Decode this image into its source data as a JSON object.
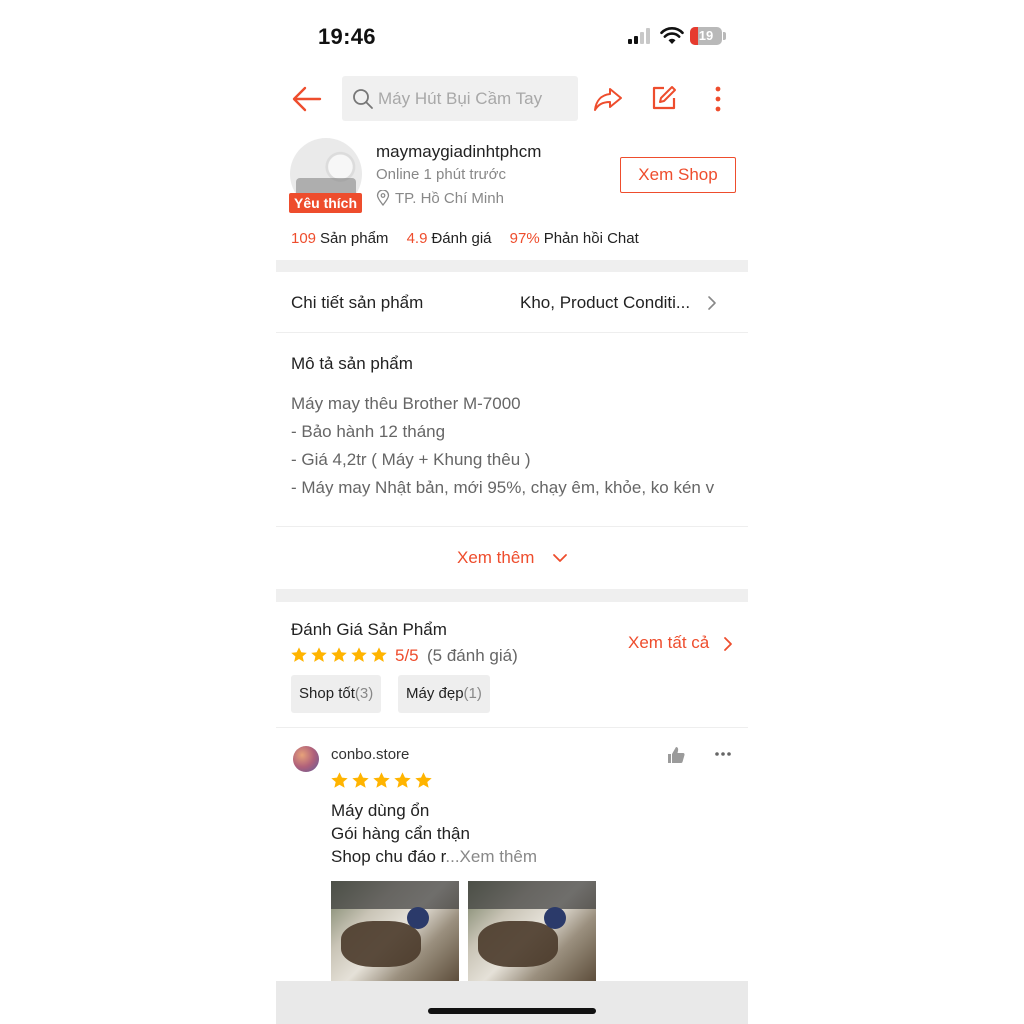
{
  "status_bar": {
    "time": "19:46",
    "battery": "19",
    "battery_color": "#e63b2e"
  },
  "nav": {
    "search_placeholder": "Máy Hút Bụi Cầm Tay",
    "accent": "#ee4d2d"
  },
  "shop": {
    "badge": "Yêu thích",
    "name": "maymaygiadinhtphcm",
    "online": "Online 1 phút trước",
    "location": "TP. Hồ Chí Minh",
    "view_button": "Xem Shop",
    "stats": [
      {
        "value": "109",
        "label": "Sản phẩm"
      },
      {
        "value": "4.9",
        "label": "Đánh giá"
      },
      {
        "value": "97%",
        "label": "Phản hồi Chat"
      }
    ]
  },
  "details": {
    "label": "Chi tiết sản phẩm",
    "value": "Kho, Product Conditi..."
  },
  "description": {
    "title": "Mô tả sản phẩm",
    "lines": [
      "Máy may thêu Brother M-7000",
      "- Bảo hành 12 tháng",
      "- Giá 4,2tr ( Máy + Khung thêu )",
      "- Máy may Nhật bản, mới 95%, chạy êm, khỏe, ko kén v"
    ],
    "see_more": "Xem thêm"
  },
  "reviews": {
    "title": "Đánh Giá Sản Phẩm",
    "score": "5/5",
    "count": "(5 đánh giá)",
    "view_all": "Xem tất cả",
    "star_color": "#ffb400",
    "stars": 5,
    "chips": [
      {
        "label": "Shop tốt",
        "count": "(3)"
      },
      {
        "label": "Máy đẹp",
        "count": "(1)"
      }
    ],
    "items": [
      {
        "user": "conbo.store",
        "stars": 5,
        "lines": [
          "Máy dùng ổn",
          "Gói hàng cẩn thận",
          "Shop chu đáo r"
        ],
        "more": "...Xem thêm",
        "photos": 2
      }
    ]
  }
}
